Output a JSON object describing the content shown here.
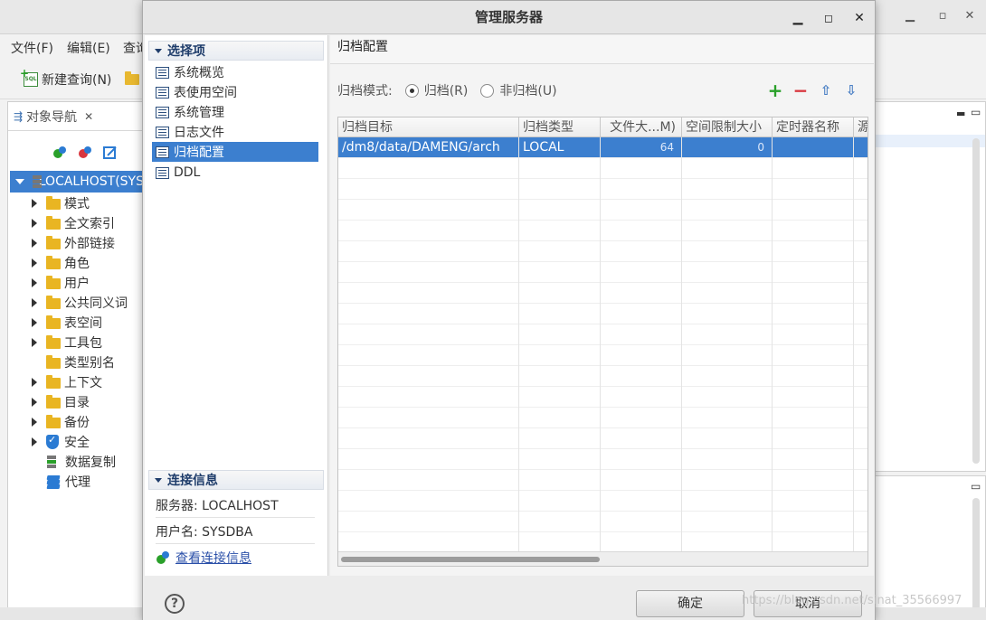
{
  "background_window": {
    "menu": [
      "文件(F)",
      "编辑(E)",
      "查询"
    ],
    "toolbar": {
      "new_query_label": "新建查询(N)"
    },
    "navigator": {
      "tab_label": "对象导航",
      "root": "LOCALHOST(SYS",
      "items": [
        "模式",
        "全文索引",
        "外部链接",
        "角色",
        "用户",
        "公共同义词",
        "表空间",
        "工具包",
        "类型别名",
        "上下文",
        "目录",
        "备份",
        "安全",
        "数据复制",
        "代理"
      ]
    }
  },
  "dialog": {
    "title": "管理服务器",
    "options_header": "选择项",
    "options": [
      "系统概览",
      "表使用空间",
      "系统管理",
      "日志文件",
      "归档配置",
      "DDL"
    ],
    "selected_option": "归档配置",
    "connection_header": "连接信息",
    "server": "服务器: LOCALHOST",
    "username": "用户名: SYSDBA",
    "view_connection": "查看连接信息",
    "panel_title": "归档配置",
    "archive_mode_label": "归档模式:",
    "archive_on": "归档(R)",
    "archive_off": "非归档(U)",
    "archive_selected": "归档(R)",
    "table": {
      "columns": [
        "归档目标",
        "归档类型",
        "文件大...M)",
        "空间限制大小",
        "定时器名称",
        "源"
      ],
      "rows": [
        [
          "/dm8/data/DAMENG/arch",
          "LOCAL",
          "64",
          "0",
          "",
          ""
        ]
      ]
    },
    "buttons": {
      "ok": "确定",
      "cancel": "取消"
    }
  },
  "watermark": "https://blog.csdn.net/sinat_35566997",
  "colors": {
    "selection": "#3c7fcf",
    "add": "#2aa02a",
    "remove": "#d9363e",
    "move": "#4a7fc4"
  }
}
